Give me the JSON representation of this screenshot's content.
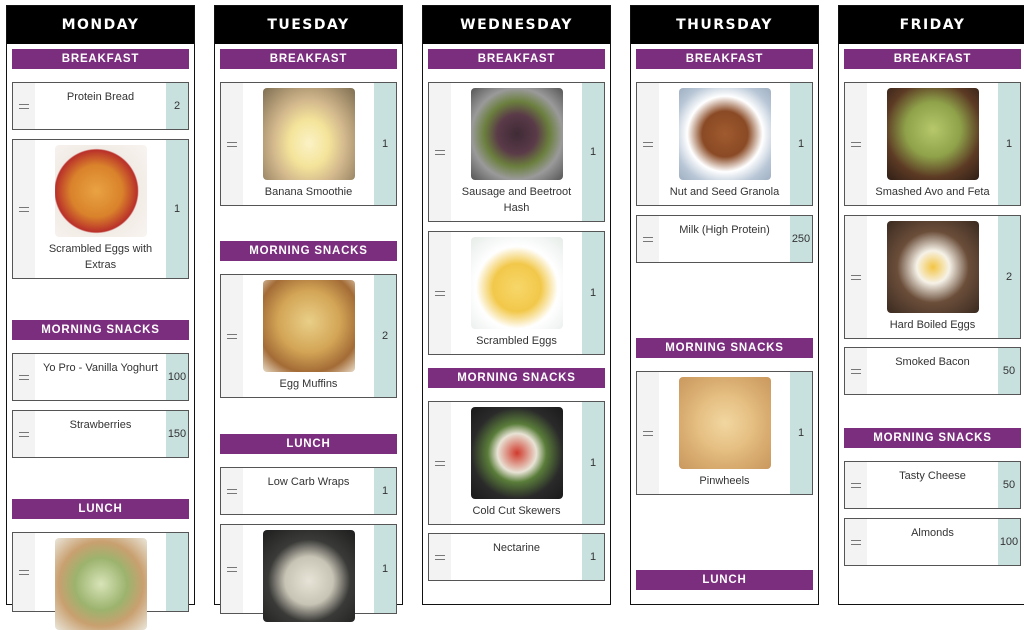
{
  "days": [
    {
      "name": "MONDAY",
      "meals": [
        {
          "title": "BREAKFAST",
          "items": [
            {
              "name": "Protein Bread",
              "qty": "2"
            },
            {
              "name": "Scrambled Eggs with Extras",
              "qty": "1",
              "icon": "scrambled-eggs-photo"
            }
          ]
        },
        {
          "title": "MORNING SNACKS",
          "items": [
            {
              "name": "Yo Pro - Vanilla Yoghurt",
              "qty": "100"
            },
            {
              "name": "Strawberries",
              "qty": "150"
            }
          ]
        },
        {
          "title": "LUNCH",
          "items": [
            {
              "name": "",
              "qty": "",
              "icon": "salad-photo"
            }
          ]
        }
      ]
    },
    {
      "name": "TUESDAY",
      "meals": [
        {
          "title": "BREAKFAST",
          "items": [
            {
              "name": "Banana Smoothie",
              "qty": "1",
              "icon": "smoothie-photo"
            }
          ]
        },
        {
          "title": "MORNING SNACKS",
          "items": [
            {
              "name": "Egg Muffins",
              "qty": "2",
              "icon": "egg-muffins-photo"
            }
          ]
        },
        {
          "title": "LUNCH",
          "items": [
            {
              "name": "Low Carb Wraps",
              "qty": "1"
            },
            {
              "name": "",
              "qty": "1",
              "icon": "rice-dish-photo"
            }
          ]
        }
      ]
    },
    {
      "name": "WEDNESDAY",
      "meals": [
        {
          "title": "BREAKFAST",
          "items": [
            {
              "name": "Sausage and Beetroot Hash",
              "qty": "1",
              "icon": "hash-photo"
            },
            {
              "name": "Scrambled Eggs",
              "qty": "1",
              "icon": "scrambled-eggs-photo"
            }
          ]
        },
        {
          "title": "MORNING SNACKS",
          "items": [
            {
              "name": "Cold Cut Skewers",
              "qty": "1",
              "icon": "skewers-photo"
            },
            {
              "name": "Nectarine",
              "qty": "1"
            }
          ]
        }
      ]
    },
    {
      "name": "THURSDAY",
      "meals": [
        {
          "title": "BREAKFAST",
          "items": [
            {
              "name": "Nut and Seed Granola",
              "qty": "1",
              "icon": "granola-photo"
            },
            {
              "name": "Milk (High Protein)",
              "qty": "250"
            }
          ]
        },
        {
          "title": "MORNING SNACKS",
          "items": [
            {
              "name": "Pinwheels",
              "qty": "1",
              "icon": "pinwheels-photo"
            }
          ]
        },
        {
          "title": "LUNCH",
          "items": []
        }
      ]
    },
    {
      "name": "FRIDAY",
      "meals": [
        {
          "title": "BREAKFAST",
          "items": [
            {
              "name": "Smashed Avo and Feta",
              "qty": "1",
              "icon": "avocado-toast-photo"
            },
            {
              "name": "Hard Boiled Eggs",
              "qty": "2",
              "icon": "boiled-eggs-photo"
            },
            {
              "name": "Smoked Bacon",
              "qty": "50"
            }
          ]
        },
        {
          "title": "MORNING SNACKS",
          "items": [
            {
              "name": "Tasty Cheese",
              "qty": "50"
            },
            {
              "name": "Almonds",
              "qty": "100"
            }
          ]
        }
      ]
    }
  ]
}
